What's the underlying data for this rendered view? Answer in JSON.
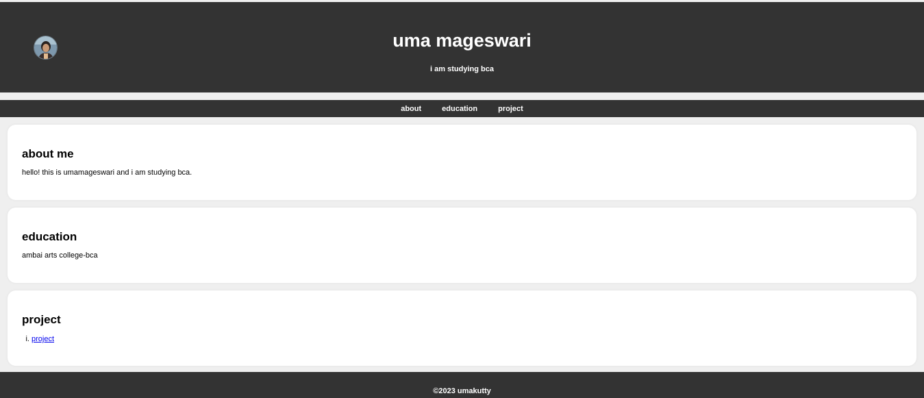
{
  "header": {
    "name": "uma mageswari",
    "tagline": "i am studying bca"
  },
  "nav": [
    {
      "label": "about"
    },
    {
      "label": "education"
    },
    {
      "label": "project"
    }
  ],
  "sections": {
    "about": {
      "heading": "about me",
      "text": "hello! this is umamageswari and i am studying bca."
    },
    "education": {
      "heading": "education",
      "text": "ambai arts college-bca"
    },
    "project": {
      "heading": "project",
      "items": [
        {
          "label": "project"
        }
      ]
    }
  },
  "footer": {
    "text": "©2023 umakutty"
  },
  "colors": {
    "header_bg": "#333333",
    "page_bg": "#efefef",
    "card_bg": "#ffffff",
    "link": "#0000ee"
  }
}
